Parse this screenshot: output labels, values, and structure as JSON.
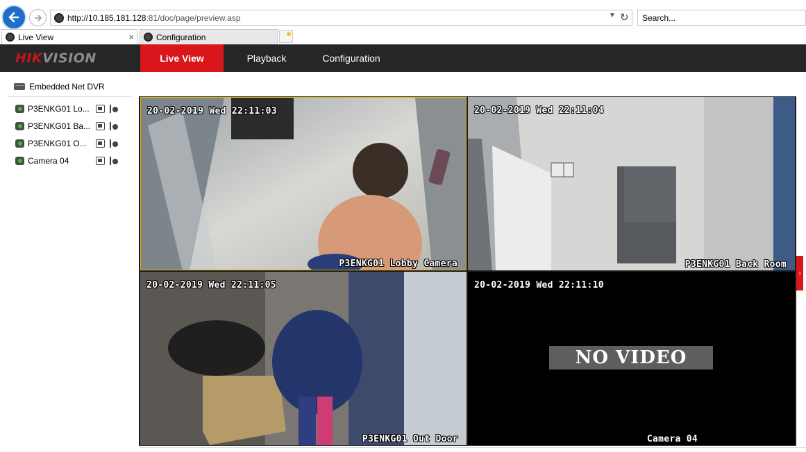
{
  "browser": {
    "url_host": "http://10.185.181.128",
    "url_rest": ":81/doc/page/preview.asp",
    "search_placeholder": "Search...",
    "tabs": [
      {
        "label": "Live View",
        "active": true
      },
      {
        "label": "Configuration",
        "active": false
      }
    ]
  },
  "app": {
    "logo_red": "HIK",
    "logo_grey": "VISION",
    "nav": [
      {
        "label": "Live View",
        "active": true
      },
      {
        "label": "Playback",
        "active": false
      },
      {
        "label": "Configuration",
        "active": false
      }
    ]
  },
  "sidebar": {
    "device": "Embedded Net DVR",
    "cameras": [
      {
        "label": "P3ENKG01 Lobby Camera",
        "shown": "P3ENKG01 Lo..."
      },
      {
        "label": "P3ENKG01 Back Room",
        "shown": "P3ENKG01 Ba..."
      },
      {
        "label": "P3ENKG01 Out Door",
        "shown": "P3ENKG01 O..."
      },
      {
        "label": "Camera 04",
        "shown": "Camera 04"
      }
    ]
  },
  "video": {
    "tiles": [
      {
        "timestamp": "20-02-2019 Wed 22:11:03",
        "name": "P3ENKG01 Lobby Camera",
        "selected": true
      },
      {
        "timestamp": "20-02-2019 Wed 22:11:04",
        "name": "P3ENKG01 Back Room",
        "selected": false
      },
      {
        "timestamp": "20-02-2019 Wed 22:11:05",
        "name": "P3ENKG01 Out Door",
        "selected": false
      },
      {
        "timestamp": "20-02-2019 Wed 22:11:10",
        "name": "Camera 04",
        "no_video": "NO VIDEO",
        "selected": false
      }
    ]
  },
  "colors": {
    "accent_red": "#d8161b",
    "nav_bg": "#262626",
    "selected_border": "#e6b800"
  }
}
